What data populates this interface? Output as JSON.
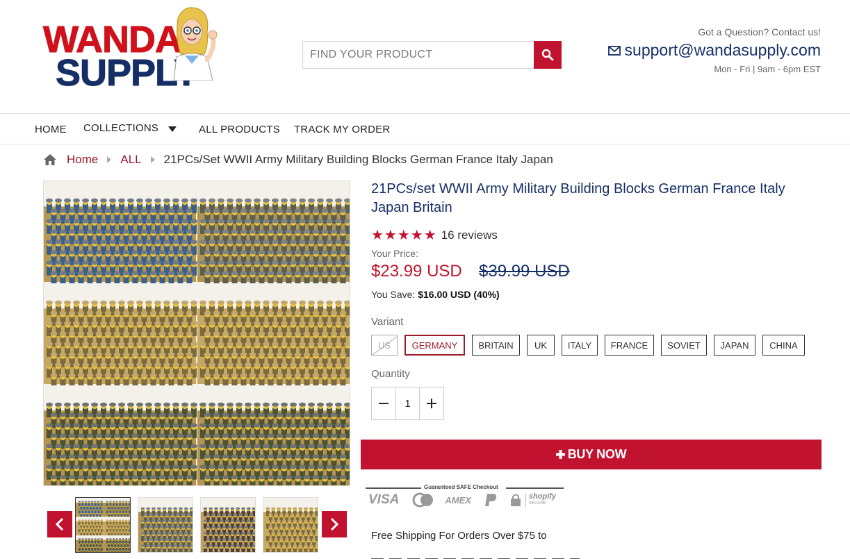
{
  "brand": {
    "line1": "WANDA",
    "line2": "SUPPLY"
  },
  "search": {
    "placeholder": "FIND YOUR PRODUCT",
    "icon": "search-icon"
  },
  "contact": {
    "question": "Got a Question? Contact us!",
    "email": "support@wandasupply.com",
    "hours": "Mon - Fri | 9am - 6pm EST"
  },
  "nav": {
    "items": [
      "HOME",
      "COLLECTIONS",
      "ALL PRODUCTS",
      "TRACK MY ORDER"
    ]
  },
  "breadcrumb": {
    "home": "Home",
    "all": "ALL",
    "current": "21PCs/Set WWII Army Military Building Blocks German France Italy Japan"
  },
  "product": {
    "title": "21PCs/set WWII Army Military Building Blocks German France Italy Japan Britain",
    "stars": "★★★★★",
    "reviews": "16 reviews",
    "price_label": "Your Price:",
    "price": "$23.99 USD",
    "compare_price": "$39.99 USD",
    "save_label": "You Save:",
    "save_value": "$16.00 USD (40%)",
    "variant_label": "Variant",
    "variants": [
      "US",
      "GERMANY",
      "BRITAIN",
      "UK",
      "ITALY",
      "FRANCE",
      "SOVIET",
      "JAPAN",
      "CHINA"
    ],
    "selected_variant": "GERMANY",
    "unavailable_variant": "US",
    "quantity_label": "Quantity",
    "quantity": "1",
    "buy_label": "BUY NOW",
    "safe_checkout": "Guaranteed SAFE Checkout",
    "payment_logos": [
      "VISA",
      "AMEX",
      "shopify"
    ],
    "shopify_sub": "SECURE",
    "shipping_text": "Free Shipping For Orders Over $75 to"
  },
  "colors": {
    "brand_red": "#c1122f",
    "brand_navy": "#152f66",
    "link_red": "#9b1b2b"
  }
}
